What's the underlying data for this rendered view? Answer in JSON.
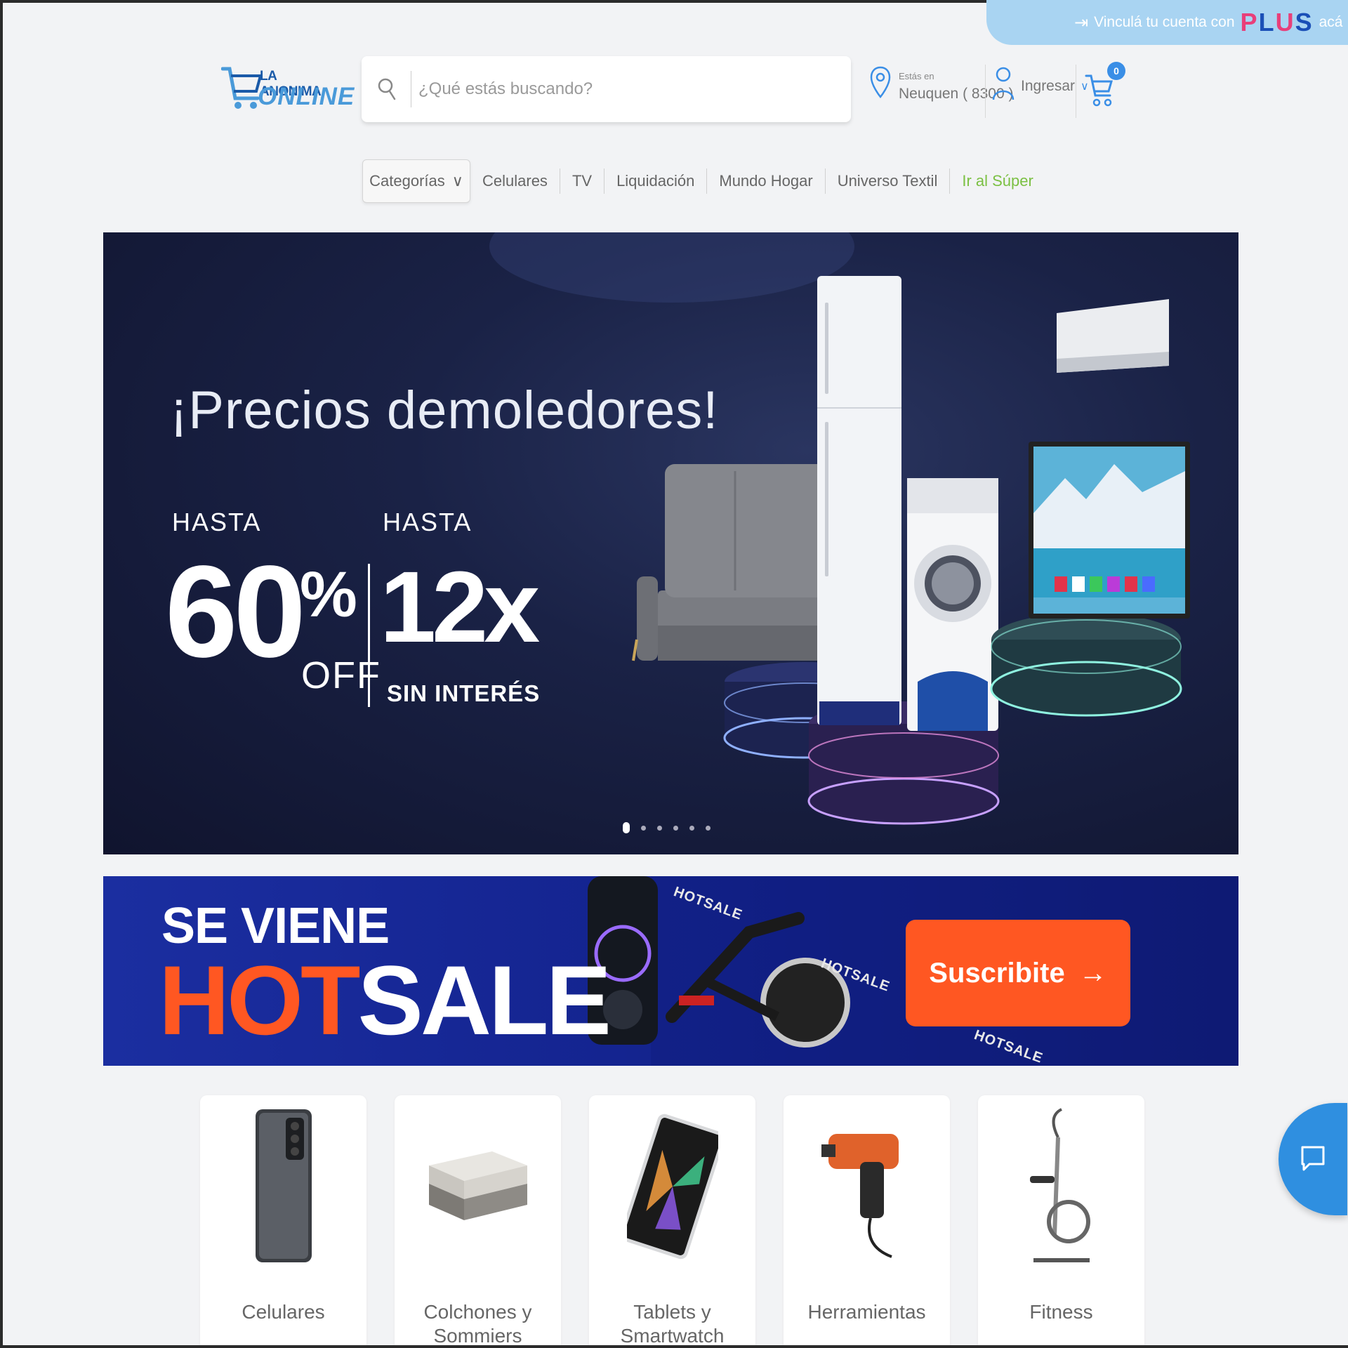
{
  "promo_strip": {
    "text": "Vinculá tu cuenta con",
    "brand": "PLUS",
    "suffix": "acá"
  },
  "header": {
    "logo_line1": "LA ANONIMA",
    "logo_line2": "ONLINE",
    "search_placeholder": "¿Qué estás buscando?",
    "location_label": "Estás en",
    "location_value": "Neuquen ( 8300 )",
    "login_label": "Ingresar",
    "cart_count": "0"
  },
  "nav": {
    "categories_label": "Categorías",
    "items": [
      "Celulares",
      "TV",
      "Liquidación",
      "Mundo Hogar",
      "Universo Textil"
    ],
    "super_label": "Ir al Súper"
  },
  "hero": {
    "headline": "¡Precios demoledores!",
    "left_prefix": "HASTA",
    "left_value": "60",
    "left_percent": "%",
    "left_suffix": "OFF",
    "right_prefix": "HASTA",
    "right_value": "12x",
    "right_suffix": "SIN INTERÉS",
    "slide_count": 6,
    "active_slide": 1
  },
  "hotsale": {
    "line1": "SE VIENE",
    "hot": "HOT",
    "sale": "SALE",
    "button_label": "Suscribite",
    "tag": "HOTSALE"
  },
  "categories": [
    {
      "label": "Celulares",
      "icon": "phone-image"
    },
    {
      "label": "Colchones y Sommiers",
      "icon": "mattress-image"
    },
    {
      "label": "Tablets y Smartwatch",
      "icon": "tablet-image"
    },
    {
      "label": "Herramientas",
      "icon": "drill-image"
    },
    {
      "label": "Fitness",
      "icon": "exercise-bike-image"
    }
  ],
  "colors": {
    "accent_blue": "#3a8ee6",
    "hotsale_orange": "#ff5722",
    "super_green": "#7bc043",
    "hero_bg": "#141a3a"
  }
}
